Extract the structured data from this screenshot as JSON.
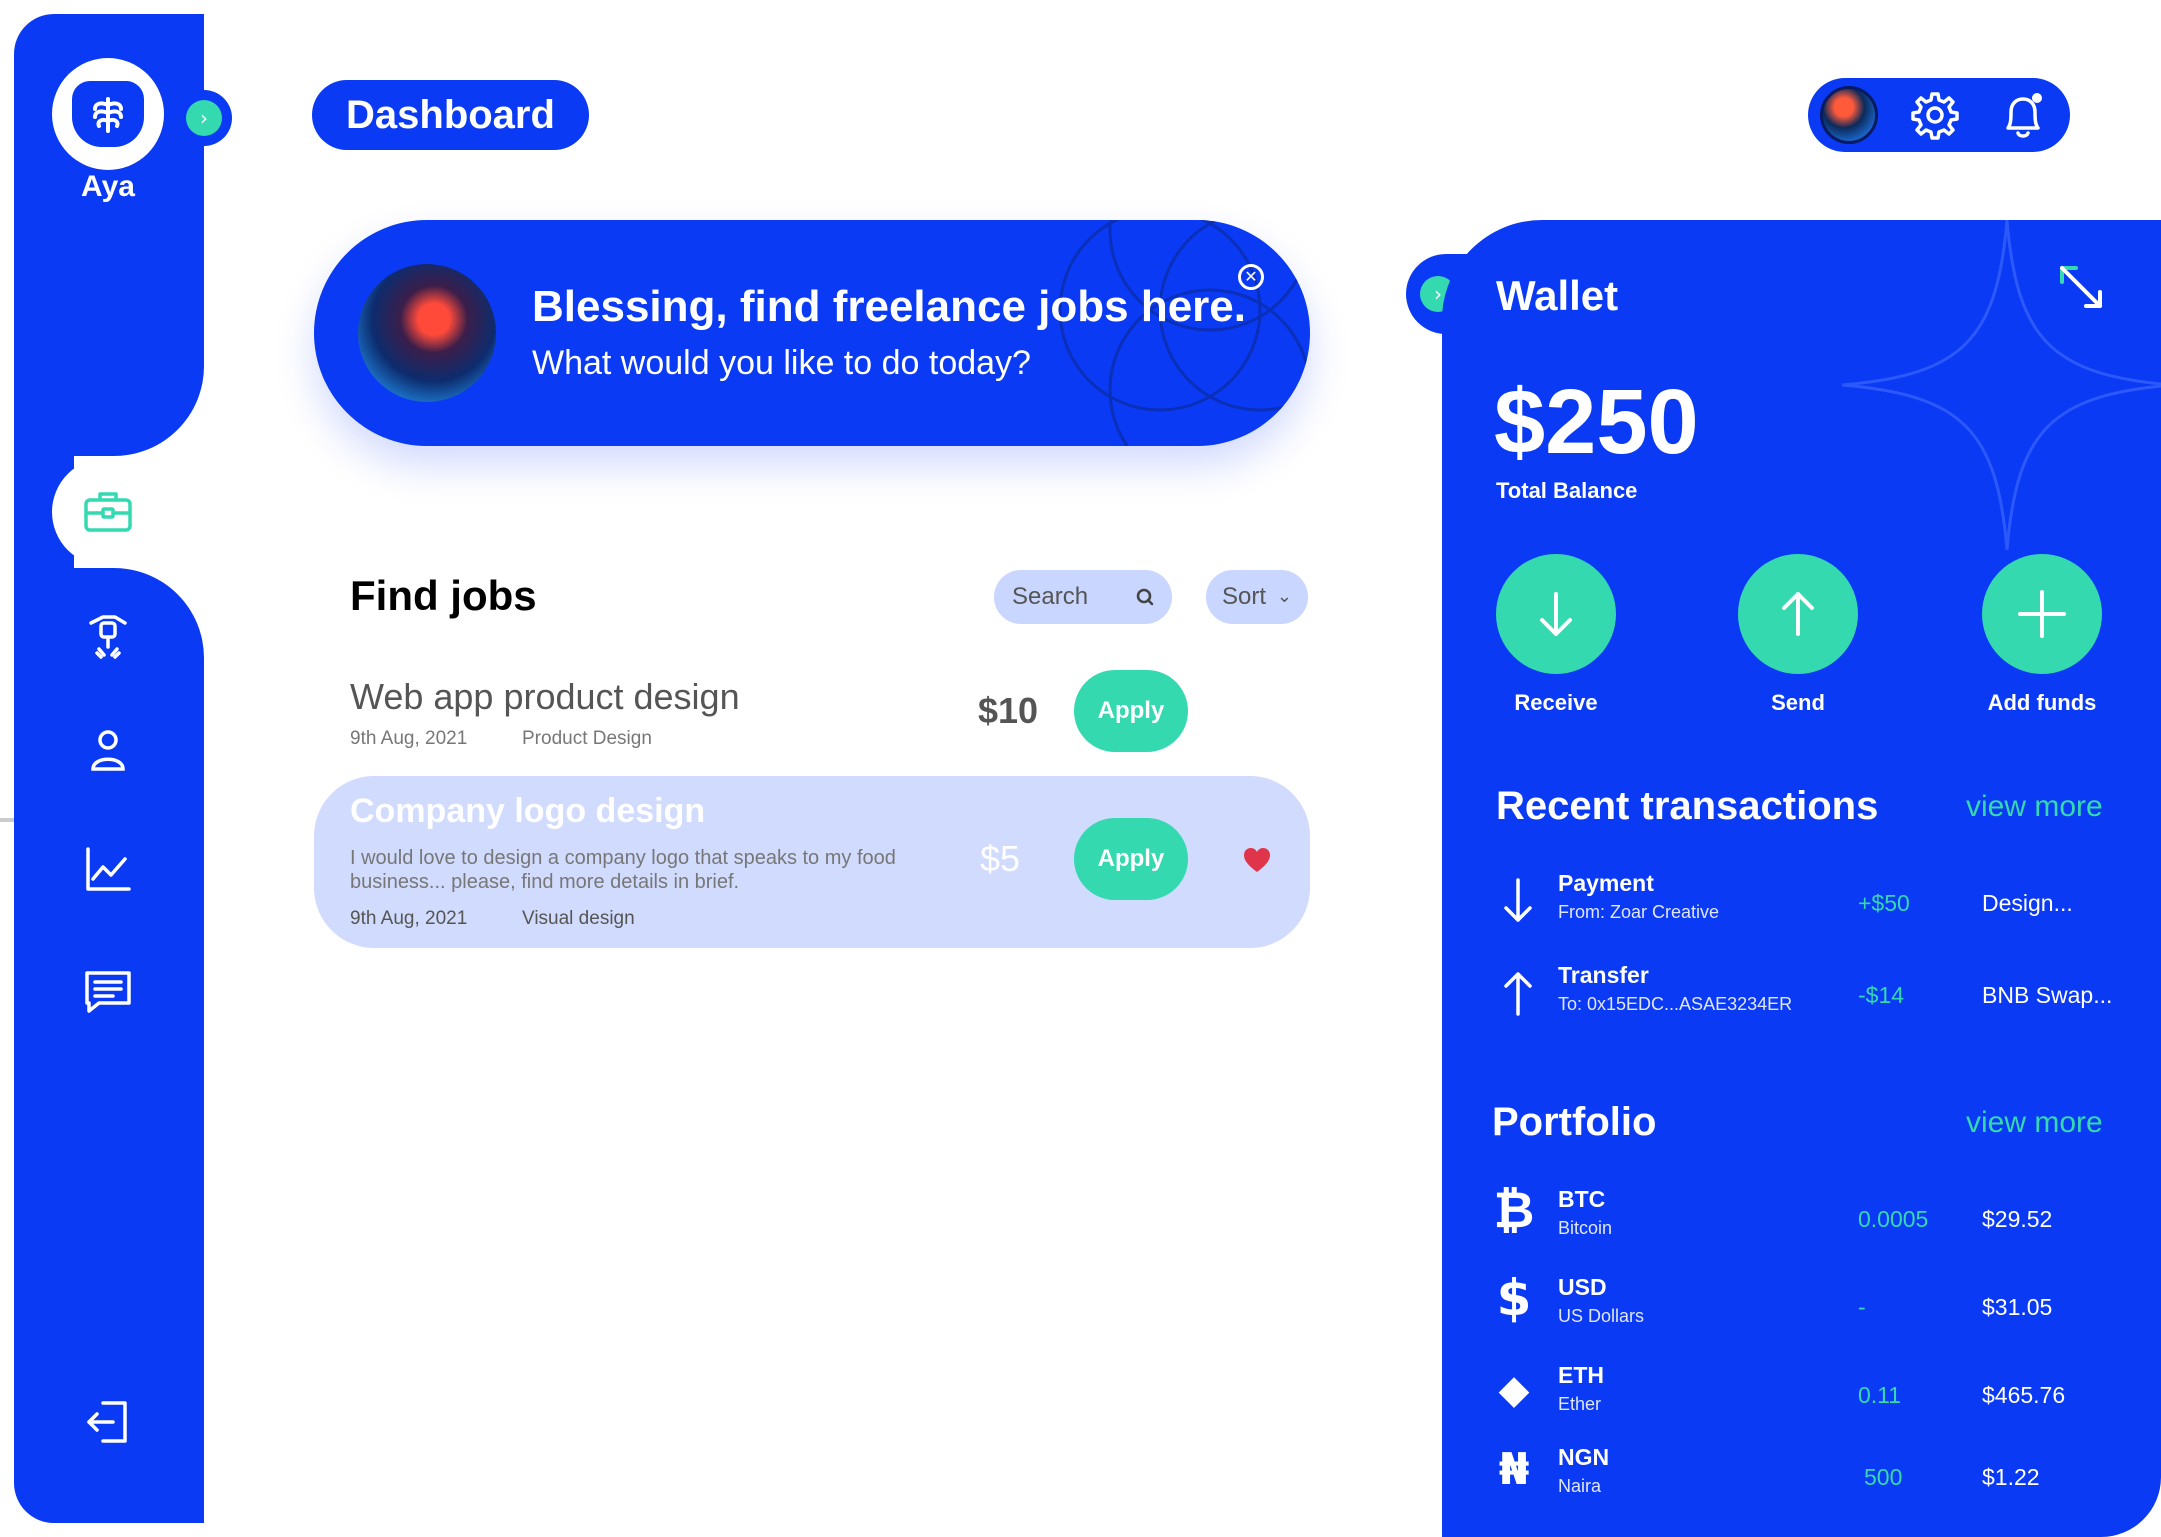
{
  "sidebar": {
    "brand": "Aya",
    "items": [
      {
        "name": "jobs",
        "icon": "briefcase-icon"
      },
      {
        "name": "tools",
        "icon": "tools-icon"
      },
      {
        "name": "profile",
        "icon": "user-icon"
      },
      {
        "name": "analytics",
        "icon": "chart-icon"
      },
      {
        "name": "messages",
        "icon": "chat-icon"
      }
    ],
    "logout_icon": "logout-icon"
  },
  "header": {
    "title": "Dashboard"
  },
  "banner": {
    "title": "Blessing, find freelance jobs here.",
    "subtitle": "What would you like to do today?"
  },
  "jobs": {
    "title": "Find jobs",
    "search_placeholder": "Search",
    "sort_label": "Sort",
    "items": [
      {
        "title": "Web app product design",
        "date": "9th Aug, 2021",
        "category": "Product Design",
        "price": "$10",
        "apply_label": "Apply"
      },
      {
        "title": "Company logo design",
        "description": "I would love to design a company logo that speaks to my food business... please, find more details in brief.",
        "date": "9th Aug, 2021",
        "category": "Visual design",
        "price": "$5",
        "apply_label": "Apply"
      }
    ]
  },
  "wallet": {
    "title": "Wallet",
    "balance": "$250",
    "balance_label": "Total Balance",
    "actions": [
      {
        "label": "Receive",
        "icon": "arrow-down-icon"
      },
      {
        "label": "Send",
        "icon": "arrow-up-icon"
      },
      {
        "label": "Add funds",
        "icon": "plus-icon"
      }
    ],
    "transactions_title": "Recent transactions",
    "view_more": "view more",
    "transactions": [
      {
        "title": "Payment",
        "sub": "From: Zoar Creative",
        "amount": "+$50",
        "note": "Design..."
      },
      {
        "title": "Transfer",
        "sub": "To: 0x15EDC...ASAE3234ER",
        "amount": "-$14",
        "note": "BNB Swap..."
      }
    ],
    "portfolio_title": "Portfolio",
    "portfolio": [
      {
        "symbol": "BTC",
        "name": "Bitcoin",
        "amount": "0.0005",
        "value": "$29.52",
        "glyph": "₿"
      },
      {
        "symbol": "USD",
        "name": "US Dollars",
        "amount": "-",
        "value": "$31.05",
        "glyph": "$"
      },
      {
        "symbol": "ETH",
        "name": "Ether",
        "amount": "0.11",
        "value": "$465.76",
        "glyph": "◆"
      },
      {
        "symbol": "NGN",
        "name": "Naira",
        "amount": "500",
        "value": "$1.22",
        "glyph": "₦"
      }
    ]
  },
  "colors": {
    "primary": "#0a3af3",
    "accent": "#34d9b0",
    "highlight": "#d1dbfd",
    "heart": "#e0344a"
  }
}
